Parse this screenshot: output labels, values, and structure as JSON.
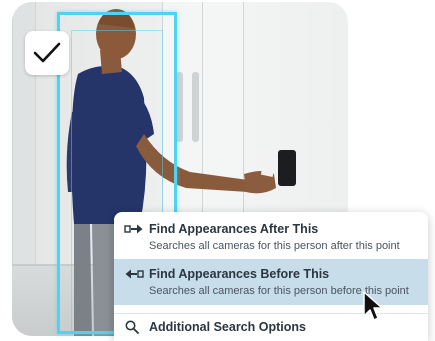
{
  "menu": {
    "items": [
      {
        "title": "Find Appearances After This",
        "subtitle": "Searches all cameras for this person after this point",
        "icon": "arrow-right-icon",
        "highlighted": false
      },
      {
        "title": "Find Appearances Before This",
        "subtitle": "Searches all cameras for this person before this point",
        "icon": "arrow-left-icon",
        "highlighted": true
      },
      {
        "title": "Additional Search Options",
        "icon": "search-icon",
        "highlighted": false
      }
    ]
  },
  "colors": {
    "tracking_box": "#4fd3ef",
    "highlight": "#c7dde9",
    "text": "#2b3640"
  },
  "icons": [
    "checkmark-icon",
    "arrow-right-icon",
    "arrow-left-icon",
    "search-icon",
    "mouse-cursor-icon"
  ]
}
